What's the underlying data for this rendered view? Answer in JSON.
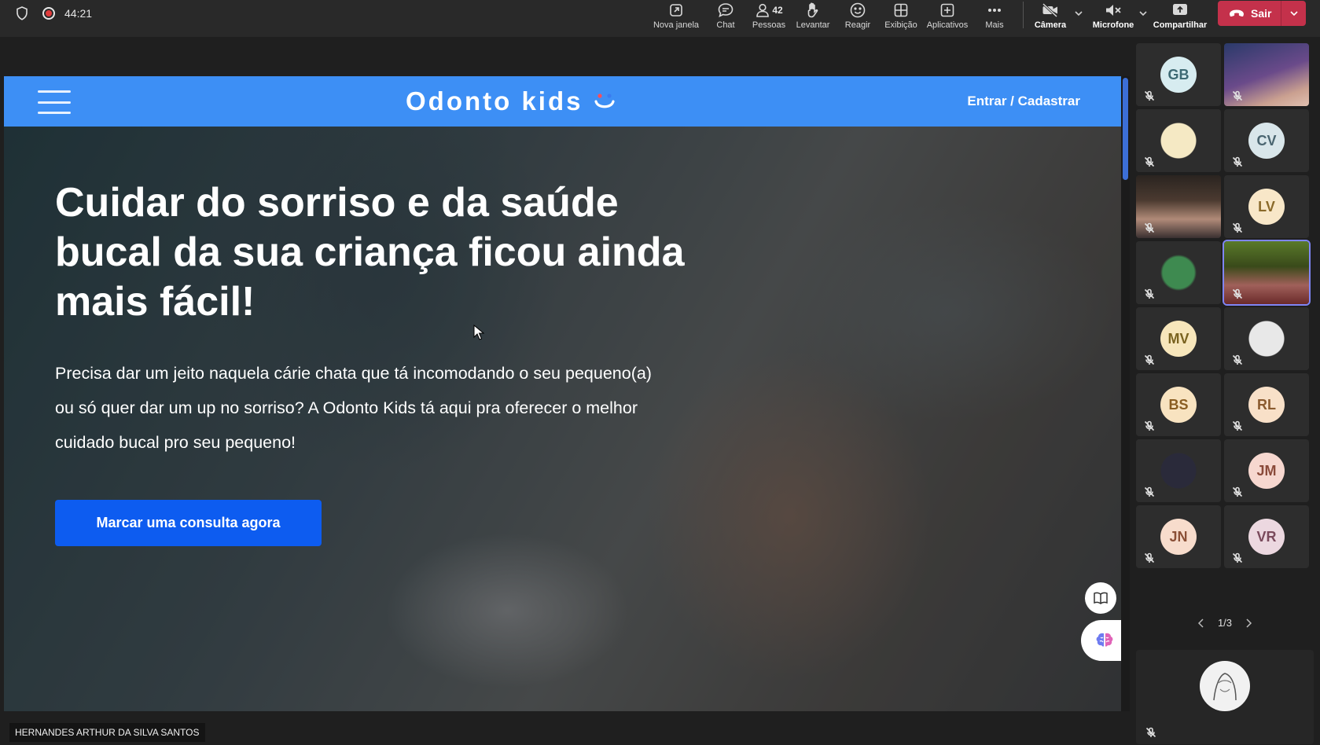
{
  "toolbar": {
    "timer": "44:21",
    "new_window": "Nova janela",
    "chat": "Chat",
    "people": "Pessoas",
    "people_count": "42",
    "raise": "Levantar",
    "react": "Reagir",
    "view": "Exibição",
    "apps": "Aplicativos",
    "more": "Mais",
    "camera": "Câmera",
    "mic": "Microfone",
    "share": "Compartilhar",
    "leave": "Sair",
    "leave_color": "#c4314b"
  },
  "website": {
    "logo_text": "Odonto kids",
    "login_link": "Entrar / Cadastrar",
    "header_color": "#3d8ff5",
    "hero_title": "Cuidar do sorriso e da saúde bucal da sua criança ficou ainda mais fácil!",
    "hero_text": "Precisa dar um jeito naquela cárie chata que tá incomodando o seu pequeno(a) ou só quer dar um up no sorriso? A Odonto Kids tá aqui pra oferecer o melhor cuidado bucal pro seu pequeno!",
    "cta_label": "Marcar uma consulta agora",
    "cta_color": "#0d5cf0"
  },
  "presenter_name": "HERNANDES ARTHUR DA SILVA SANTOS",
  "participants": [
    {
      "initials": "GB",
      "bg": "#d7ecf0",
      "fg": "#3e6a74"
    },
    {
      "initials": "",
      "video": true
    },
    {
      "initials": "",
      "image": true
    },
    {
      "initials": "CV",
      "bg": "#d9e6ea",
      "fg": "#4a6570"
    },
    {
      "initials": "",
      "video": true
    },
    {
      "initials": "LV",
      "bg": "#f8e7c8",
      "fg": "#8a6a2a"
    },
    {
      "initials": "",
      "image": true
    },
    {
      "initials": "",
      "video": true,
      "active": true
    },
    {
      "initials": "MV",
      "bg": "#f7e6bb",
      "fg": "#7a6320"
    },
    {
      "initials": "",
      "image": true
    },
    {
      "initials": "BS",
      "bg": "#f8e3c0",
      "fg": "#8a5e22"
    },
    {
      "initials": "RL",
      "bg": "#f8e0c8",
      "fg": "#8a5a2e"
    },
    {
      "initials": "",
      "image": true
    },
    {
      "initials": "JM",
      "bg": "#f6d7cf",
      "fg": "#8a4a3a"
    },
    {
      "initials": "JN",
      "bg": "#f7dccc",
      "fg": "#8a4f36"
    },
    {
      "initials": "VR",
      "bg": "#ecd8e0",
      "fg": "#7a4a5c"
    }
  ],
  "pager": "1/3"
}
